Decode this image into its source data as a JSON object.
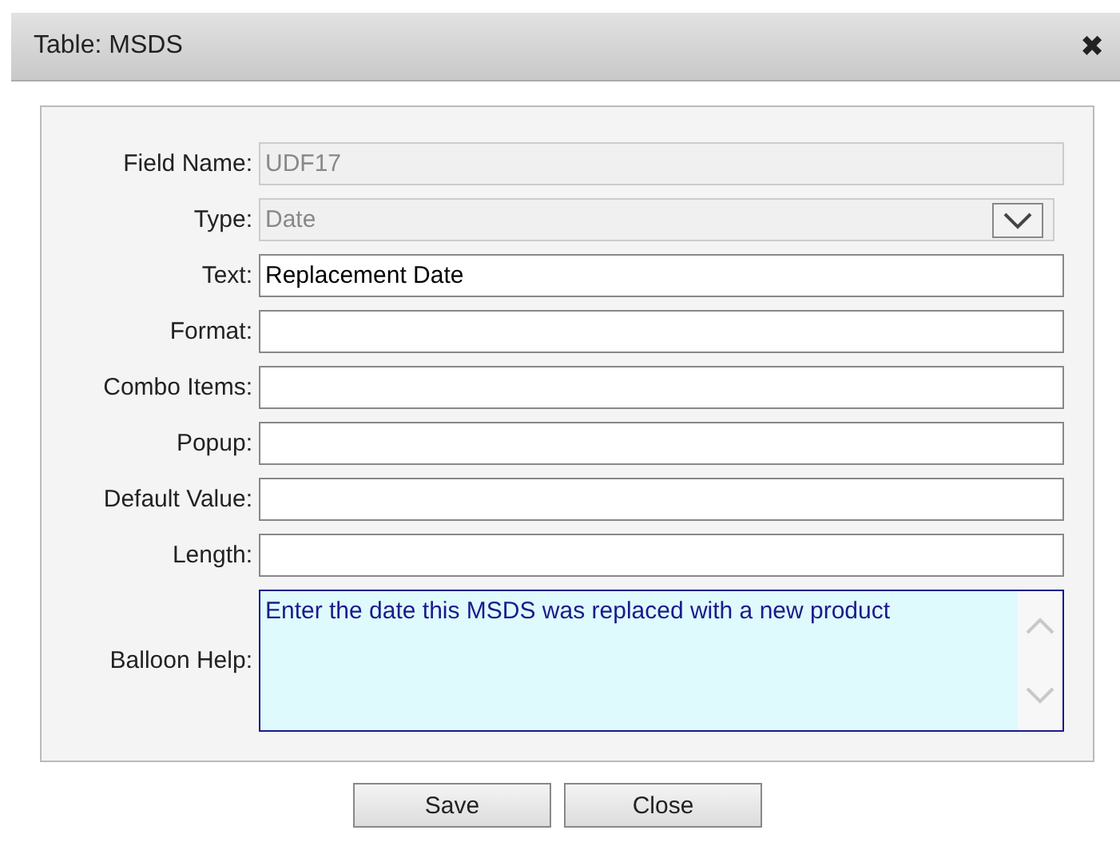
{
  "window": {
    "title": "Table: MSDS",
    "close_glyph": "✖"
  },
  "fields": [
    {
      "label": "Field Name:",
      "kind": "text",
      "value": "UDF17",
      "disabled": true
    },
    {
      "label": "Type:",
      "kind": "select",
      "value": "Date",
      "disabled": true
    },
    {
      "label": "Text:",
      "kind": "text",
      "value": "Replacement Date",
      "disabled": false
    },
    {
      "label": "Format:",
      "kind": "text",
      "disabled": false
    },
    {
      "label": "Combo Items:",
      "kind": "text",
      "disabled": false
    },
    {
      "label": "Popup:",
      "kind": "text",
      "disabled": false
    },
    {
      "label": "Default Value:",
      "kind": "text",
      "disabled": false
    },
    {
      "label": "Length:",
      "kind": "text",
      "disabled": false
    },
    {
      "label": "Balloon Help:",
      "kind": "textarea",
      "value": "Enter the date this MSDS was replaced with a new product",
      "disabled": false
    }
  ],
  "buttons": [
    "Save",
    "Close"
  ]
}
